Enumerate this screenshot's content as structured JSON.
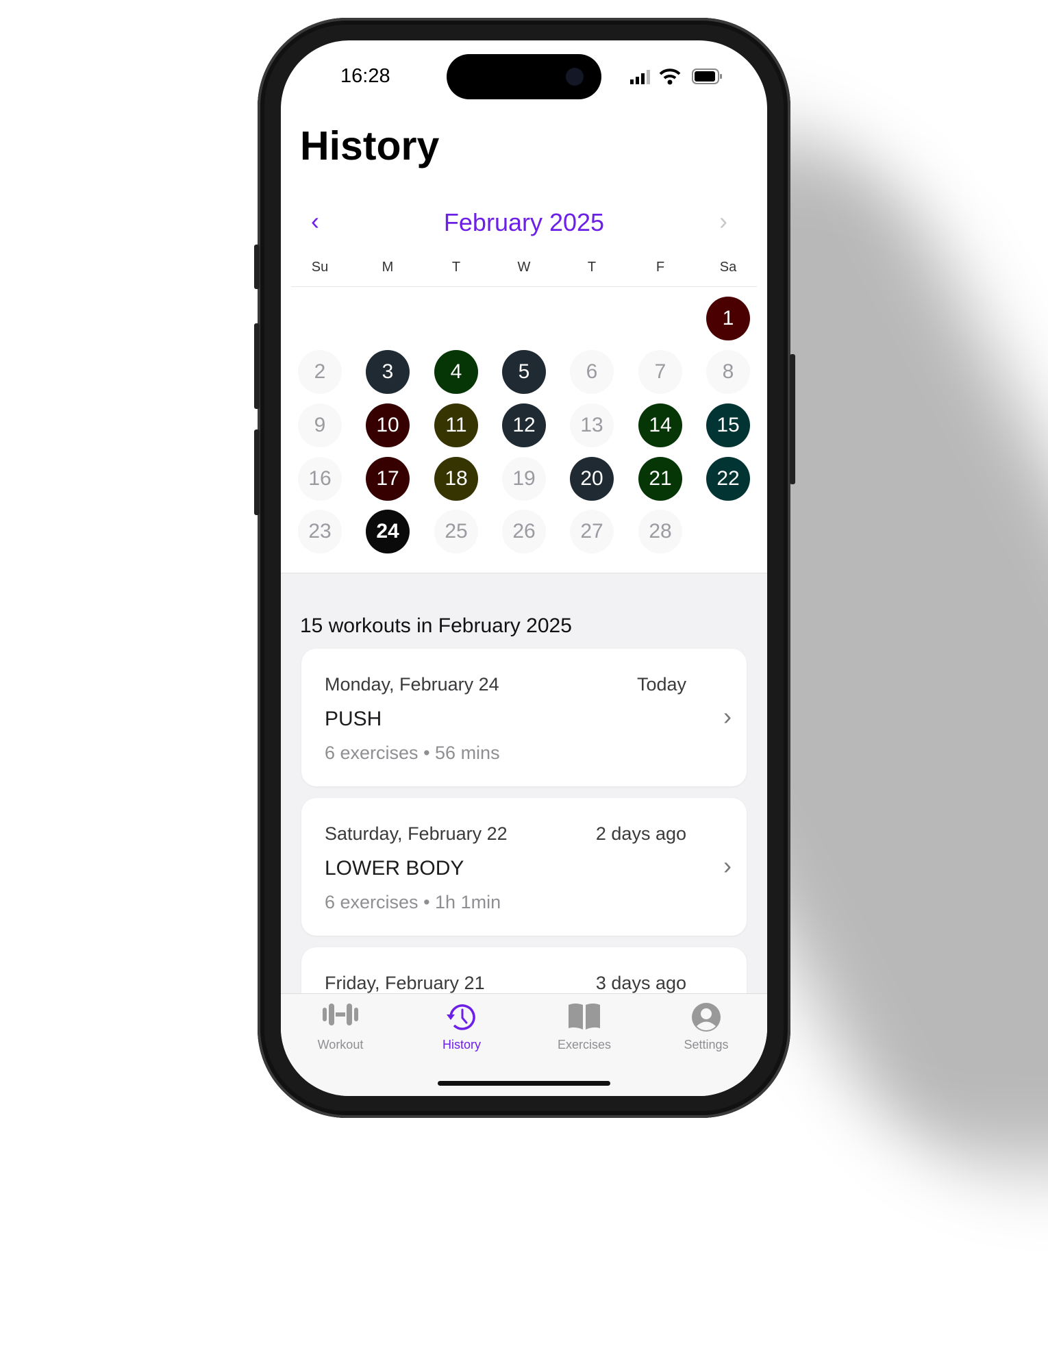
{
  "status_bar": {
    "time": "16:28"
  },
  "header": {
    "title": "History"
  },
  "calendar": {
    "month_label": "February 2025",
    "weekdays": [
      "Su",
      "M",
      "T",
      "W",
      "T",
      "F",
      "Sa"
    ],
    "first_weekday_index": 6,
    "days": [
      {
        "d": "1",
        "color": "#4a0000"
      },
      {
        "d": "2"
      },
      {
        "d": "3",
        "color": "#1f2a33"
      },
      {
        "d": "4",
        "color": "#063606"
      },
      {
        "d": "5",
        "color": "#1f2a33"
      },
      {
        "d": "6"
      },
      {
        "d": "7"
      },
      {
        "d": "8"
      },
      {
        "d": "9"
      },
      {
        "d": "10",
        "color": "#360000"
      },
      {
        "d": "11",
        "color": "#363400"
      },
      {
        "d": "12",
        "color": "#1f2a33"
      },
      {
        "d": "13"
      },
      {
        "d": "14",
        "color": "#063606"
      },
      {
        "d": "15",
        "color": "#023434"
      },
      {
        "d": "16"
      },
      {
        "d": "17",
        "color": "#360000"
      },
      {
        "d": "18",
        "color": "#363400"
      },
      {
        "d": "19"
      },
      {
        "d": "20",
        "color": "#1f2a33"
      },
      {
        "d": "21",
        "color": "#063606"
      },
      {
        "d": "22",
        "color": "#023434"
      },
      {
        "d": "23"
      },
      {
        "d": "24",
        "color": "#0a0a0a",
        "today": true
      },
      {
        "d": "25"
      },
      {
        "d": "26"
      },
      {
        "d": "27"
      },
      {
        "d": "28"
      }
    ]
  },
  "summary": "15 workouts in February 2025",
  "workouts": [
    {
      "date": "Monday, February 24",
      "relative": "Today",
      "name": "PUSH",
      "exercises": "6 exercises",
      "duration": "56 mins"
    },
    {
      "date": "Saturday, February 22",
      "relative": "2 days ago",
      "name": "LOWER BODY",
      "exercises": "6 exercises",
      "duration": "1h 1min"
    },
    {
      "date": "Friday, February 21",
      "relative": "3 days ago"
    }
  ],
  "tabs": [
    {
      "label": "Workout",
      "icon": "dumbbell-icon"
    },
    {
      "label": "History",
      "icon": "clock-history-icon",
      "active": true
    },
    {
      "label": "Exercises",
      "icon": "book-icon"
    },
    {
      "label": "Settings",
      "icon": "person-circle-icon"
    }
  ],
  "colors": {
    "accent": "#6c1fe6"
  }
}
